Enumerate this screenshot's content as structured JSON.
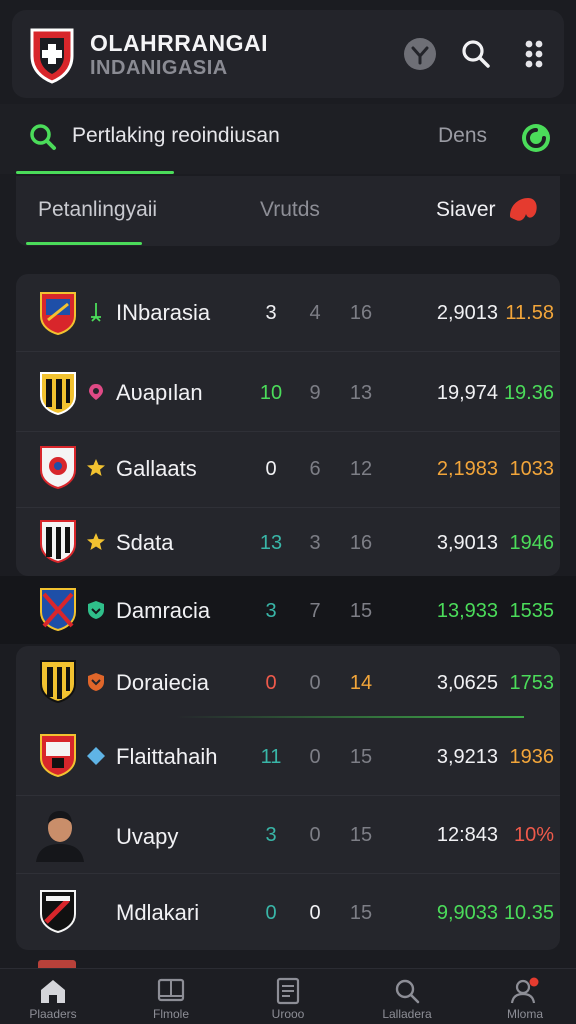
{
  "header": {
    "title": "OLAHRRANGAI",
    "subtitle": "INDANIGASIA"
  },
  "search_tabs": {
    "search_text": "Pertlaking reoindiusan",
    "right_label": "Dens"
  },
  "filter_tabs": {
    "tab1": "Petanlingyaii",
    "tab2": "Vrutds",
    "tab3": "Siaver"
  },
  "rows": [
    {
      "name": "INbarasia",
      "n1": "3",
      "n2": "4",
      "n3": "16",
      "pts": "2,9013",
      "form": "11.58"
    },
    {
      "name": "Aυapılan",
      "n1": "10",
      "n2": "9",
      "n3": "13",
      "pts": "19,974",
      "form": "19.36"
    },
    {
      "name": "Gallaats",
      "n1": "0",
      "n2": "6",
      "n3": "12",
      "pts": "2,1983",
      "form": "1033"
    },
    {
      "name": "Sdata",
      "n1": "13",
      "n2": "3",
      "n3": "16",
      "pts": "3,9013",
      "form": "1946"
    },
    {
      "name": "Damracia",
      "n1": "3",
      "n2": "7",
      "n3": "15",
      "pts": "13,933",
      "form": "1535"
    },
    {
      "name": "Doraiecia",
      "n1": "0",
      "n2": "0",
      "n3": "14",
      "pts": "3,0625",
      "form": "1753"
    },
    {
      "name": "Flaittahaih",
      "n1": "11",
      "n2": "0",
      "n3": "15",
      "pts": "3,9213",
      "form": "1936"
    },
    {
      "name": "Uvapy",
      "n1": "3",
      "n2": "0",
      "n3": "15",
      "pts": "12:843",
      "form": "10%"
    },
    {
      "name": "Mdlakari",
      "n1": "0",
      "n2": "0",
      "n3": "15",
      "pts": "9,9033",
      "form": "10.35"
    }
  ],
  "bottom_nav": {
    "home": "Plaaders",
    "item2": "Flmole",
    "item3": "Urooo",
    "item4": "Lalladera",
    "item5": "Mloma"
  },
  "colors": {
    "accent": "#4bdc5a",
    "orange": "#f2a53a",
    "red": "#ef5a4b",
    "teal": "#39b6a8"
  }
}
